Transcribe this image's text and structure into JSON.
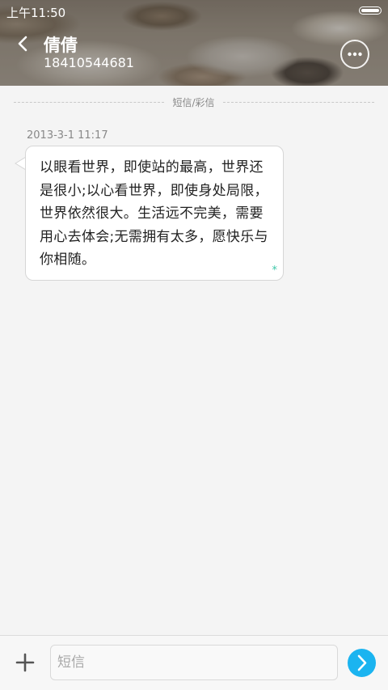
{
  "status_bar": {
    "time": "上午11:50",
    "battery_icon": "battery-icon"
  },
  "header": {
    "back_icon": "chevron-left-icon",
    "contact_name": "倩倩",
    "contact_number": "18410544681",
    "more_icon": "more-dots-icon"
  },
  "conversation": {
    "divider_label": "短信/彩信",
    "messages": [
      {
        "timestamp": "2013-3-1 11:17",
        "text": "以眼看世界，即使站的最高，世界还是很小;以心看世界，即使身处局限，世界依然很大。生活远不完美，需要用心去体会;无需拥有太多，愿快乐与你相随。",
        "status_icon": "star-icon",
        "status_glyph": "*",
        "direction": "incoming"
      }
    ]
  },
  "input_bar": {
    "add_icon": "plus-icon",
    "placeholder": "短信",
    "value": "",
    "send_icon": "send-arrow-icon"
  },
  "colors": {
    "accent": "#1bb4f0",
    "star": "#3cc6a8",
    "background": "#f4f4f4"
  }
}
